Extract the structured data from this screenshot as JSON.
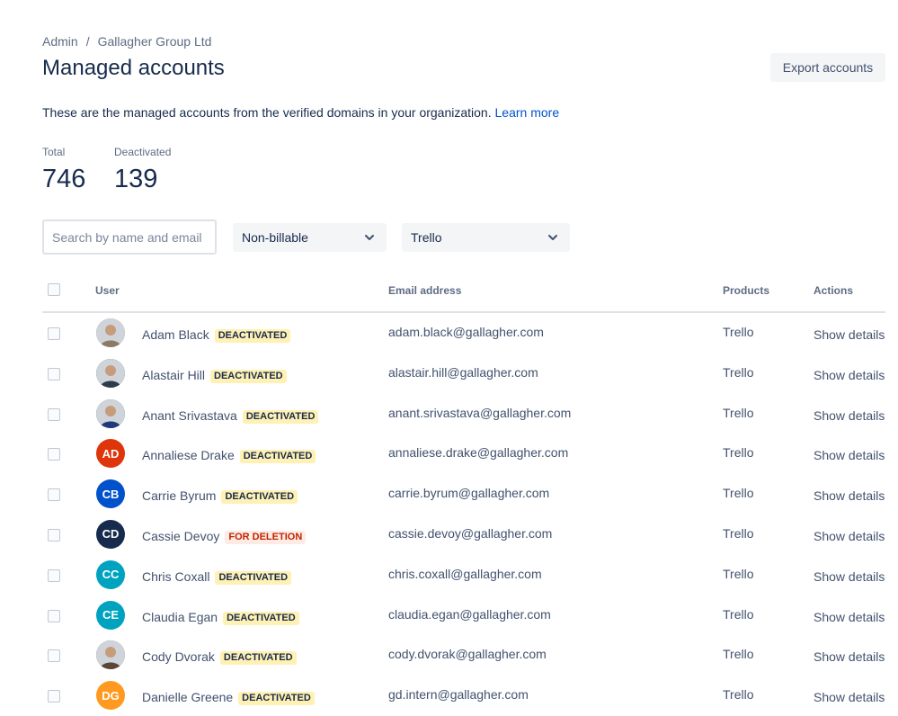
{
  "breadcrumb": {
    "root": "Admin",
    "separator": "/",
    "org": "Gallagher Group Ltd"
  },
  "title": "Managed accounts",
  "export_label": "Export accounts",
  "description": {
    "text": "These are the managed accounts from the verified domains in your organization. ",
    "link": "Learn more"
  },
  "stats": {
    "total_label": "Total",
    "total_value": "746",
    "deactivated_label": "Deactivated",
    "deactivated_value": "139"
  },
  "filters": {
    "search_placeholder": "Search by name and email",
    "billing": "Non-billable",
    "product": "Trello"
  },
  "columns": {
    "user": "User",
    "email": "Email address",
    "products": "Products",
    "actions": "Actions"
  },
  "colors": {
    "deactivated_badge_bg": "#fff0b3",
    "deletion_badge_text": "#bf2600",
    "link": "#0052cc"
  },
  "rows": [
    {
      "name": "Adam Black",
      "status": "DEACTIVATED",
      "email": "adam.black@gallagher.com",
      "product": "Trello",
      "action": "Show details",
      "avatar": "photo",
      "initials": "",
      "color": "#8c7b64"
    },
    {
      "name": "Alastair Hill",
      "status": "DEACTIVATED",
      "email": "alastair.hill@gallagher.com",
      "product": "Trello",
      "action": "Show details",
      "avatar": "photo",
      "initials": "",
      "color": "#2f3a4a"
    },
    {
      "name": "Anant Srivastava",
      "status": "DEACTIVATED",
      "email": "anant.srivastava@gallagher.com",
      "product": "Trello",
      "action": "Show details",
      "avatar": "photo",
      "initials": "",
      "color": "#1f3a78"
    },
    {
      "name": "Annaliese Drake",
      "status": "DEACTIVATED",
      "email": "annaliese.drake@gallagher.com",
      "product": "Trello",
      "action": "Show details",
      "avatar": "initials",
      "initials": "AD",
      "color": "#de350b"
    },
    {
      "name": "Carrie Byrum",
      "status": "DEACTIVATED",
      "email": "carrie.byrum@gallagher.com",
      "product": "Trello",
      "action": "Show details",
      "avatar": "initials",
      "initials": "CB",
      "color": "#0052cc"
    },
    {
      "name": "Cassie Devoy",
      "status": "FOR DELETION",
      "email": "cassie.devoy@gallagher.com",
      "product": "Trello",
      "action": "Show details",
      "avatar": "initials",
      "initials": "CD",
      "color": "#172b4d"
    },
    {
      "name": "Chris Coxall",
      "status": "DEACTIVATED",
      "email": "chris.coxall@gallagher.com",
      "product": "Trello",
      "action": "Show details",
      "avatar": "initials",
      "initials": "CC",
      "color": "#00a3bf"
    },
    {
      "name": "Claudia Egan",
      "status": "DEACTIVATED",
      "email": "claudia.egan@gallagher.com",
      "product": "Trello",
      "action": "Show details",
      "avatar": "initials",
      "initials": "CE",
      "color": "#00a3bf"
    },
    {
      "name": "Cody Dvorak",
      "status": "DEACTIVATED",
      "email": "cody.dvorak@gallagher.com",
      "product": "Trello",
      "action": "Show details",
      "avatar": "photo",
      "initials": "",
      "color": "#5a4636"
    },
    {
      "name": "Danielle Greene",
      "status": "DEACTIVATED",
      "email": "gd.intern@gallagher.com",
      "product": "Trello",
      "action": "Show details",
      "avatar": "initials",
      "initials": "DG",
      "color": "#ff991f"
    }
  ]
}
